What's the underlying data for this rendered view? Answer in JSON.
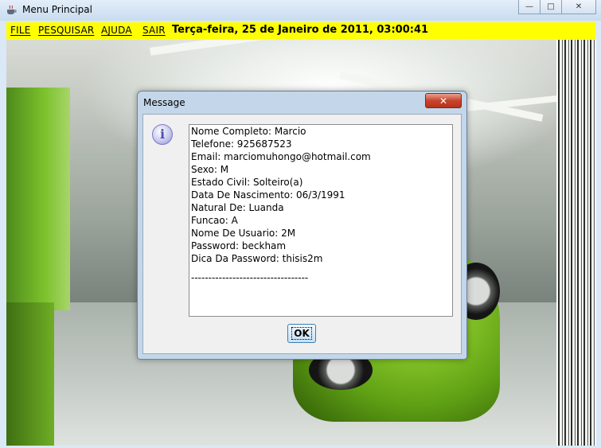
{
  "window": {
    "title": "Menu Principal",
    "controls": {
      "minimize": "—",
      "maximize": "□",
      "close": "✕"
    }
  },
  "menubar": {
    "items": [
      {
        "label": "FILE"
      },
      {
        "label": "PESQUISAR"
      },
      {
        "label": "AJUDA"
      },
      {
        "label": "SAIR"
      }
    ],
    "clock": "Terça-feira, 25 de Janeiro de 2011, 03:00:41",
    "background_color": "#ffff00"
  },
  "dialog": {
    "title": "Message",
    "close_label": "✕",
    "icon": "info-icon",
    "icon_glyph": "i",
    "lines": [
      "Nome Completo: Marcio",
      "Telefone: 925687523",
      "Email: marciomuhongo@hotmail.com",
      "Sexo: M",
      "Estado Civil: Solteiro(a)",
      "Data De Nascimento: 06/3/1991",
      "Natural De: Luanda",
      "Funcao: A",
      "Nome De Usuario: 2M",
      "Password: beckham",
      "Dica Da Password: thisis2m"
    ],
    "separator": "----------------------------------",
    "ok_label": "OK"
  }
}
